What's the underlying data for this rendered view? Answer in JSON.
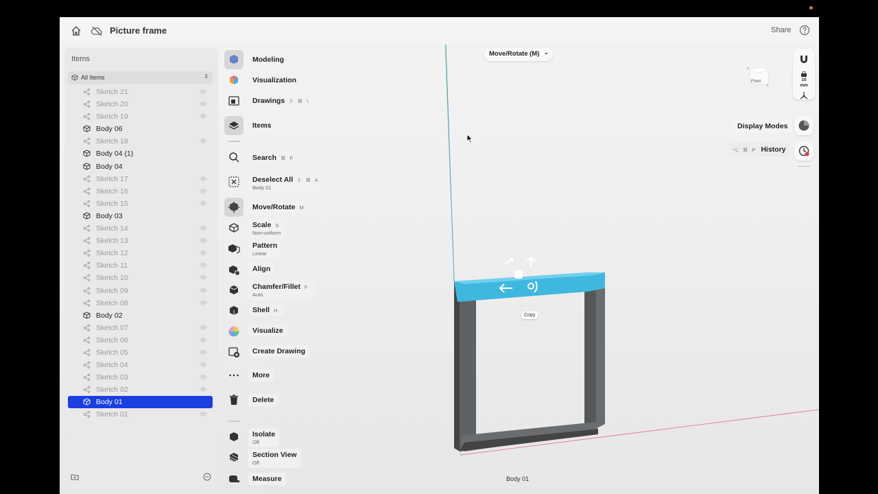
{
  "header": {
    "title": "Picture frame",
    "share_label": "Share",
    "icons": [
      "home-icon",
      "cloud-off-icon",
      "help-icon"
    ]
  },
  "items_panel": {
    "title": "Items",
    "filter_label": "All Items",
    "rows": [
      {
        "label": "Sketch 21",
        "kind": "sketch",
        "selected": false
      },
      {
        "label": "Sketch 20",
        "kind": "sketch",
        "selected": false
      },
      {
        "label": "Sketch 19",
        "kind": "sketch",
        "selected": false
      },
      {
        "label": "Body 06",
        "kind": "body",
        "selected": false
      },
      {
        "label": "Sketch 18",
        "kind": "sketch",
        "selected": false
      },
      {
        "label": "Body 04 (1)",
        "kind": "body",
        "selected": false
      },
      {
        "label": "Body 04",
        "kind": "body",
        "selected": false
      },
      {
        "label": "Sketch 17",
        "kind": "sketch",
        "selected": false
      },
      {
        "label": "Sketch 16",
        "kind": "sketch",
        "selected": false
      },
      {
        "label": "Sketch 15",
        "kind": "sketch",
        "selected": false
      },
      {
        "label": "Body 03",
        "kind": "body",
        "selected": false
      },
      {
        "label": "Sketch 14",
        "kind": "sketch",
        "selected": false
      },
      {
        "label": "Sketch 13",
        "kind": "sketch",
        "selected": false
      },
      {
        "label": "Sketch 12",
        "kind": "sketch",
        "selected": false
      },
      {
        "label": "Sketch 11",
        "kind": "sketch",
        "selected": false
      },
      {
        "label": "Sketch 10",
        "kind": "sketch",
        "selected": false
      },
      {
        "label": "Sketch 09",
        "kind": "sketch",
        "selected": false
      },
      {
        "label": "Sketch 08",
        "kind": "sketch",
        "selected": false
      },
      {
        "label": "Body 02",
        "kind": "body",
        "selected": false
      },
      {
        "label": "Sketch 07",
        "kind": "sketch",
        "selected": false
      },
      {
        "label": "Sketch 06",
        "kind": "sketch",
        "selected": false
      },
      {
        "label": "Sketch 05",
        "kind": "sketch",
        "selected": false
      },
      {
        "label": "Sketch 04",
        "kind": "sketch",
        "selected": false
      },
      {
        "label": "Sketch 03",
        "kind": "sketch",
        "selected": false
      },
      {
        "label": "Sketch 02",
        "kind": "sketch",
        "selected": false
      },
      {
        "label": "Body 01",
        "kind": "body",
        "selected": true
      },
      {
        "label": "Sketch 01",
        "kind": "sketch",
        "selected": false
      }
    ]
  },
  "toolbar": {
    "modeling": {
      "label": "Modeling"
    },
    "visualization": {
      "label": "Visualization"
    },
    "drawings": {
      "label": "Drawings",
      "shortcut": "⇧ ⌘ \\"
    },
    "items": {
      "label": "Items"
    },
    "search": {
      "label": "Search",
      "shortcut": "⌘ F"
    },
    "deselect": {
      "label": "Deselect All",
      "shortcut": "⇧ ⌘ A",
      "sub": "Body 01"
    },
    "move_rotate": {
      "label": "Move/Rotate",
      "shortcut": "M"
    },
    "scale": {
      "label": "Scale",
      "shortcut": "S",
      "sub": "Non-uniform"
    },
    "pattern": {
      "label": "Pattern",
      "sub": "Linear"
    },
    "align": {
      "label": "Align"
    },
    "chamfer": {
      "label": "Chamfer/Fillet",
      "shortcut": "F",
      "sub": "Auto"
    },
    "shell": {
      "label": "Shell",
      "shortcut": "H"
    },
    "visualize": {
      "label": "Visualize"
    },
    "create_drawing": {
      "label": "Create Drawing"
    },
    "more": {
      "label": "More"
    },
    "delete": {
      "label": "Delete"
    },
    "isolate": {
      "label": "Isolate",
      "sub": "Off"
    },
    "section_view": {
      "label": "Section View",
      "sub": "Off"
    },
    "measure": {
      "label": "Measure"
    }
  },
  "viewport": {
    "mode_selector": "Move/Rotate (M)",
    "view_cube_label": "Front",
    "grid_size": "10",
    "grid_unit": "mm",
    "display_modes_label": "Display Modes",
    "history_label": "History",
    "history_shortcut": "⌥ ⌘ P",
    "copy_label": "Copy",
    "status_selection": "Body 01"
  },
  "colors": {
    "selection": "#1a3fe0",
    "highlight_body": "#3fb8e0",
    "frame": "#5f6264",
    "y_axis": "#4a8fe6",
    "x_axis": "#e06a7a",
    "z_axis": "#7fcf6a"
  }
}
